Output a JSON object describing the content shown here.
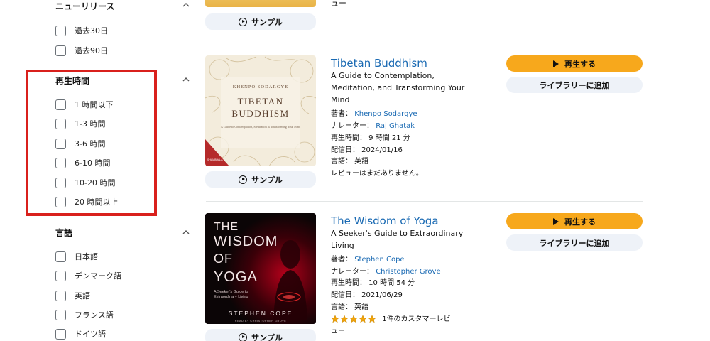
{
  "sidebar": {
    "new_release": {
      "title": "ニューリリース",
      "options": [
        "過去30日",
        "過去90日"
      ]
    },
    "duration": {
      "title": "再生時間",
      "options": [
        "1 時間以下",
        "1-3 時間",
        "3-6 時間",
        "6-10 時間",
        "10-20 時間",
        "20 時間以上"
      ]
    },
    "language": {
      "title": "言語",
      "options": [
        "日本語",
        "デンマーク語",
        "英語",
        "フランス語",
        "ドイツ語"
      ]
    }
  },
  "results": {
    "sample_label": "サンプル",
    "play_label": "再生する",
    "library_label": "ライブラリーに追加",
    "top_partial_text": "ュー",
    "items": [
      {
        "title": "Tibetan Buddhism",
        "subtitle": "A Guide to Contemplation, Meditation, and Transforming Your Mind",
        "author_label": "著者：",
        "author": "Khenpo Sodargye",
        "narrator_label": "ナレーター：",
        "narrator": "Raj Ghatak",
        "length": "再生時間： 9 時間 21 分",
        "release": "配信日： 2024/01/16",
        "language": "言語： 英語",
        "reviews": "レビューはまだありません。",
        "cover": {
          "author": "KHENPO SODARGYE",
          "title_line1": "TIBETAN",
          "title_line2": "BUDDHISM",
          "tagline": "A Guide to Contemplation, Meditation & Transforming Your Mind",
          "ribbon": "SHAMBHALA"
        }
      },
      {
        "title": "The Wisdom of Yoga",
        "subtitle": "A Seeker's Guide to Extraordinary Living",
        "author_label": "著者：",
        "author": "Stephen Cope",
        "narrator_label": "ナレーター：",
        "narrator": "Christopher Grove",
        "length": "再生時間： 10 時間 54 分",
        "release": "配信日： 2021/06/29",
        "language": "言語： 英語",
        "rating": 5,
        "reviews_line1": "1件のカスタマーレビ",
        "reviews_line2": "ュー",
        "cover": {
          "title_line1": "THE",
          "title_line2": "WISDOM",
          "title_line3": "OF",
          "title_line4": "YOGA",
          "tagline1": "A Seeker's Guide to",
          "tagline2": "Extraordinary Living",
          "author": "STEPHEN COPE",
          "reader": "READ BY CHRISTOPHER GROVE"
        }
      }
    ]
  },
  "colors": {
    "link": "#1a6ab3",
    "play_button": "#f7a81c",
    "secondary_button": "#eef2f8",
    "highlight_box": "#d9201c",
    "star": "#f0a30a"
  }
}
